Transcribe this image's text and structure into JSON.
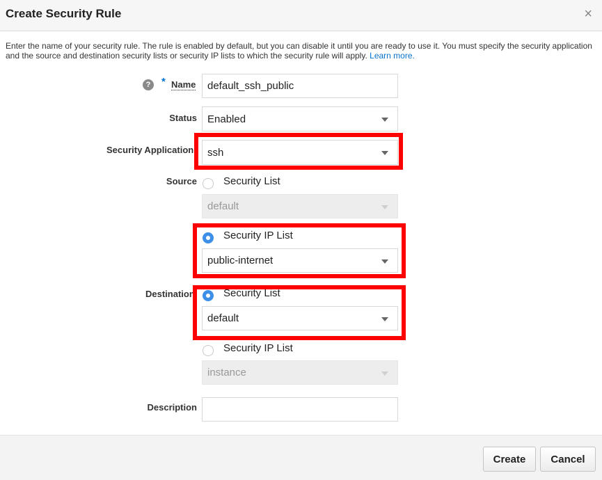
{
  "dialog": {
    "title": "Create Security Rule",
    "close_glyph": "×",
    "intro": "Enter the name of your security rule. The rule is enabled by default, but you can disable it until you are ready to use it. You must specify the security application and the source and destination security lists or security IP lists to which the security rule will apply.",
    "learn_more": "Learn more."
  },
  "form": {
    "required_mark": "*",
    "help_glyph": "?",
    "name": {
      "label": "Name",
      "value": "default_ssh_public"
    },
    "status": {
      "label": "Status",
      "value": "Enabled"
    },
    "security_application": {
      "label": "Security Application",
      "value": "ssh"
    },
    "source": {
      "label": "Source",
      "security_list": {
        "label": "Security List",
        "selected": false,
        "value": "default"
      },
      "security_ip_list": {
        "label": "Security IP List",
        "selected": true,
        "value": "public-internet"
      }
    },
    "destination": {
      "label": "Destination",
      "security_list": {
        "label": "Security List",
        "selected": true,
        "value": "default"
      },
      "security_ip_list": {
        "label": "Security IP List",
        "selected": false,
        "value": "instance"
      }
    },
    "description": {
      "label": "Description",
      "value": ""
    }
  },
  "buttons": {
    "create": "Create",
    "cancel": "Cancel"
  },
  "colors": {
    "highlight": "#ff0000",
    "link": "#0572ce",
    "radio_selected": "#3d8fe8"
  },
  "icons": [
    "help-icon",
    "close-icon",
    "chevron-down-icon"
  ]
}
